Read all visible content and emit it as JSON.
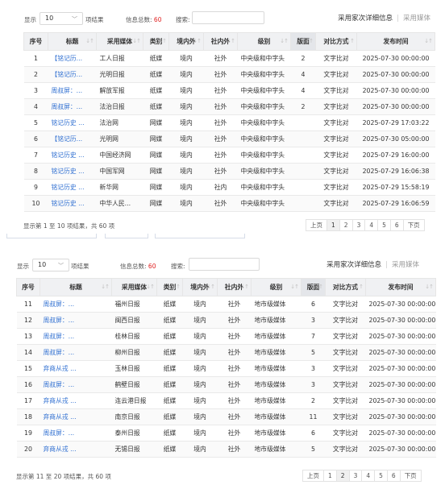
{
  "labels": {
    "show": "显示",
    "page_size": "10",
    "entries": "项结果",
    "total_label": "信息总数:",
    "total_value": "60",
    "search": "搜索:",
    "search_placeholder": ""
  },
  "tabs": {
    "active": "采用家次详细信息",
    "inactive": "采用媒体"
  },
  "columns": [
    "序号",
    "标题",
    "采用媒体",
    "类别",
    "境内外",
    "社内外",
    "级别",
    "版面",
    "对比方式",
    "发布时间"
  ],
  "panel1": {
    "rows": [
      [
        "1",
        "【铭记历...",
        "工人日报",
        "纸媒",
        "境内",
        "社外",
        "中央级和中字头",
        "2",
        "文字比对",
        "2025-07-30 00:00:00"
      ],
      [
        "2",
        "【铭记历...",
        "光明日报",
        "纸媒",
        "境内",
        "社外",
        "中央级和中字头",
        "4",
        "文字比对",
        "2025-07-30 00:00:00"
      ],
      [
        "3",
        "周叔屏：...",
        "解放军报",
        "纸媒",
        "境内",
        "社外",
        "中央级和中字头",
        "4",
        "文字比对",
        "2025-07-30 00:00:00"
      ],
      [
        "4",
        "周叔屏：...",
        "法治日报",
        "纸媒",
        "境内",
        "社外",
        "中央级和中字头",
        "2",
        "文字比对",
        "2025-07-30 00:00:00"
      ],
      [
        "5",
        "铭记历史 ...",
        "法治网",
        "网媒",
        "境内",
        "社外",
        "中央级和中字头",
        "",
        "文字比对",
        "2025-07-29 17:03:22"
      ],
      [
        "6",
        "【铭记历...",
        "光明网",
        "网媒",
        "境内",
        "社外",
        "中央级和中字头",
        "",
        "文字比对",
        "2025-07-30 05:00:00"
      ],
      [
        "7",
        "铭记历史 ...",
        "中国经济网",
        "网媒",
        "境内",
        "社外",
        "中央级和中字头",
        "",
        "文字比对",
        "2025-07-29 16:00:00"
      ],
      [
        "8",
        "铭记历史 ...",
        "中国军网",
        "网媒",
        "境内",
        "社外",
        "中央级和中字头",
        "",
        "文字比对",
        "2025-07-29 16:06:38"
      ],
      [
        "9",
        "铭记历史 ...",
        "新华网",
        "网媒",
        "境内",
        "社内",
        "中央级和中字头",
        "",
        "文字比对",
        "2025-07-29 15:58:19"
      ],
      [
        "10",
        "铭记历史 ...",
        "中华人民...",
        "网媒",
        "境内",
        "社外",
        "中央级和中字头",
        "",
        "文字比对",
        "2025-07-29 16:06:59"
      ]
    ],
    "info": "显示第 1 至 10 项结果，共 60 项",
    "pager": [
      "上页",
      "1",
      "2",
      "3",
      "4",
      "5",
      "6",
      "下页"
    ],
    "active_page": "1"
  },
  "panel2": {
    "rows": [
      [
        "11",
        "周叔屏：...",
        "福州日报",
        "纸媒",
        "境内",
        "社外",
        "地市级媒体",
        "6",
        "文字比对",
        "2025-07-30 00:00:00"
      ],
      [
        "12",
        "周叔屏：...",
        "闽西日报",
        "纸媒",
        "境内",
        "社外",
        "地市级媒体",
        "3",
        "文字比对",
        "2025-07-30 00:00:00"
      ],
      [
        "13",
        "周叔屏：...",
        "桂林日报",
        "纸媒",
        "境内",
        "社外",
        "地市级媒体",
        "7",
        "文字比对",
        "2025-07-30 00:00:00"
      ],
      [
        "14",
        "周叔屏：...",
        "柳州日报",
        "纸媒",
        "境内",
        "社外",
        "地市级媒体",
        "5",
        "文字比对",
        "2025-07-30 00:00:00"
      ],
      [
        "15",
        "弃商从戎 ...",
        "玉林日报",
        "纸媒",
        "境内",
        "社外",
        "地市级媒体",
        "3",
        "文字比对",
        "2025-07-30 00:00:00"
      ],
      [
        "16",
        "周叔屏：...",
        "鹤壁日报",
        "纸媒",
        "境内",
        "社外",
        "地市级媒体",
        "3",
        "文字比对",
        "2025-07-30 00:00:00"
      ],
      [
        "17",
        "弃商从戎 ...",
        "连云港日报",
        "纸媒",
        "境内",
        "社外",
        "地市级媒体",
        "2",
        "文字比对",
        "2025-07-30 00:00:00"
      ],
      [
        "18",
        "弃商从戎 ...",
        "南京日报",
        "纸媒",
        "境内",
        "社外",
        "地市级媒体",
        "11",
        "文字比对",
        "2025-07-30 00:00:00"
      ],
      [
        "19",
        "周叔屏：...",
        "泰州日报",
        "纸媒",
        "境内",
        "社外",
        "地市级媒体",
        "6",
        "文字比对",
        "2025-07-30 00:00:00"
      ],
      [
        "20",
        "弃商从戎 ...",
        "无锡日报",
        "纸媒",
        "境内",
        "社外",
        "地市级媒体",
        "5",
        "文字比对",
        "2025-07-30 00:00:00"
      ]
    ],
    "info": "显示第 11 至 20 项结果，共 60 项",
    "pager": [
      "上页",
      "1",
      "2",
      "3",
      "4",
      "5",
      "6",
      "下页"
    ],
    "active_page": "2"
  },
  "colors": {
    "link": "#2f6fd1",
    "total": "#e02020",
    "header_bg": "#f0f1f3"
  }
}
